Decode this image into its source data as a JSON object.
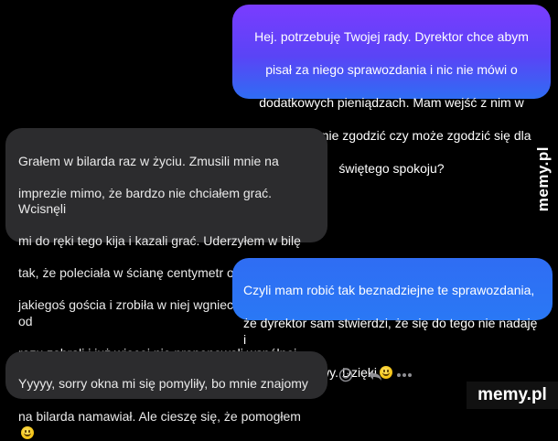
{
  "messages": [
    {
      "direction": "outgoing",
      "text": "Hej. potrzebuję Twojej rady. Dyrektor chce abym pisał za niego sprawozdania i nic nie mówi o dodatkowych pieniądzach. Mam wejść z nim w konflikt i się nie zgodzić czy może zgodzić się dla świętego spokoju?"
    },
    {
      "direction": "incoming",
      "text": "Grałem w bilarda raz w życiu. Zmusili mnie na imprezie mimo, że bardzo nie chciałem grać. Wcisnęli mi do ręki tego kija i kazali grać. Uderzyłem w bilę tak, że poleciała w ścianę centymetr od głowy jakiegoś gościa i zrobiła w niej wgniecenie. Kija mi od razu zabrali i już więcej nie proponowali wspólnej gry."
    },
    {
      "direction": "outgoing",
      "text": "Czyli mam robić tak beznadziejne te sprawozdania, że dyrektor sam stwierdzi, że się do tego nie nadaję i problem z głowy. Dzięki",
      "emoji": "smiling-face-emoji"
    },
    {
      "direction": "incoming",
      "text": "Yyyyy, sorry okna mi się pomyliły, bo mnie znajomy na bilarda namawiał. Ale cieszę się, że pomogłem",
      "emoji": "smiling-face-emoji"
    }
  ],
  "message_lines": {
    "m1": [
      "Hej. potrzebuję Twojej rady. Dyrektor chce abym",
      "pisał za niego sprawozdania i nic nie mówi o",
      "dodatkowych pieniądzach. Mam wejść z nim w",
      "konflikt i się nie zgodzić czy może zgodzić się dla",
      "świętego spokoju?"
    ],
    "m2": [
      "Grałem w bilarda raz w życiu. Zmusili mnie na",
      "imprezie mimo, że bardzo nie chciałem grać. Wcisnęli",
      "mi do ręki tego kija i kazali grać. Uderzyłem w bilę",
      "tak, że poleciała w ścianę centymetr od głowy",
      "jakiegoś gościa i zrobiła w niej wgniecenie. Kija mi od",
      "razu zabrali i już więcej nie proponowali wspólnej gry."
    ],
    "m3": [
      "Czyli mam robić tak beznadziejne te sprawozdania,",
      "że dyrektor sam stwierdzi, że się do tego nie nadaję i",
      "problem z głowy. Dzięki"
    ],
    "m4": [
      "Yyyyy, sorry okna mi się pomyliły, bo mnie znajomy",
      "na bilarda namawiał. Ale cieszę się, że pomogłem"
    ]
  },
  "actions": {
    "emoji_react_icon": "smiley-outline-icon",
    "reply_icon": "reply-arrow-icon",
    "more_icon": "more-dots-icon"
  },
  "watermark": {
    "side": "memy.pl",
    "bottom": "memy.pl"
  },
  "colors": {
    "background": "#000000",
    "incoming_bubble": "#2c2c2e",
    "outgoing_gradient_top": "#7a3cff",
    "outgoing_gradient_bottom": "#2f6df3",
    "outgoing_blue": "#2a78f5"
  }
}
